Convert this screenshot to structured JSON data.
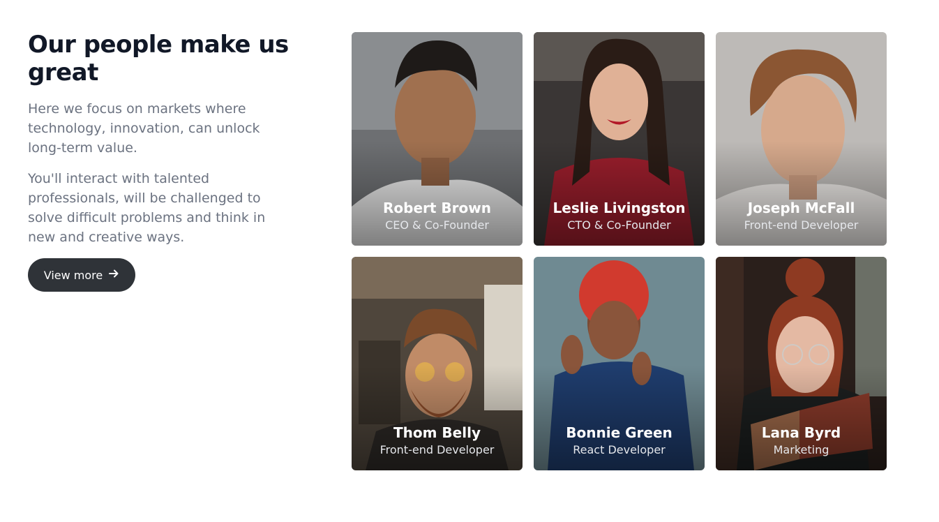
{
  "heading": "Our people make us great",
  "paragraphs": [
    "Here we focus on markets where technology, innovation, can unlock long-term value.",
    "You'll interact with talented professionals, will be challenged to solve difficult problems and think in new and creative ways."
  ],
  "button": {
    "label": "View more",
    "icon": "arrow-right-icon"
  },
  "team": [
    {
      "name": "Robert Brown",
      "role": "CEO & Co-Founder"
    },
    {
      "name": "Leslie Livingston",
      "role": "CTO & Co-Founder"
    },
    {
      "name": "Joseph McFall",
      "role": "Front-end Developer"
    },
    {
      "name": "Thom Belly",
      "role": "Front-end Developer"
    },
    {
      "name": "Bonnie Green",
      "role": "React Developer"
    },
    {
      "name": "Lana Byrd",
      "role": "Marketing"
    }
  ],
  "colors": {
    "heading": "#111827",
    "body_text": "#6b7280",
    "button_bg": "#2f3338",
    "card_text": "#ffffff"
  }
}
